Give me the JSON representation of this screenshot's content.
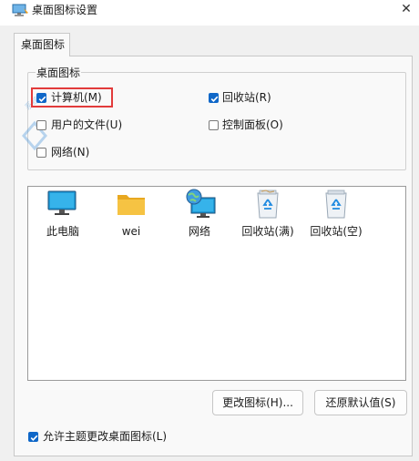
{
  "window": {
    "title": "桌面图标设置",
    "close_glyph": "✕"
  },
  "tabs": [
    {
      "label": "桌面图标"
    }
  ],
  "group": {
    "title": "桌面图标",
    "checkboxes": [
      {
        "label": "计算机(M)",
        "checked": true
      },
      {
        "label": "回收站(R)",
        "checked": true
      },
      {
        "label": "用户的文件(U)",
        "checked": false
      },
      {
        "label": "控制面板(O)",
        "checked": false
      },
      {
        "label": "网络(N)",
        "checked": false
      }
    ]
  },
  "icons": [
    {
      "label": "此电脑",
      "icon": "monitor-icon"
    },
    {
      "label": "wei",
      "icon": "folder-icon"
    },
    {
      "label": "网络",
      "icon": "network-globe-icon"
    },
    {
      "label": "回收站(满)",
      "icon": "recycle-bin-full-icon"
    },
    {
      "label": "回收站(空)",
      "icon": "recycle-bin-empty-icon"
    }
  ],
  "buttons": {
    "change_icon": "更改图标(H)...",
    "restore_default": "还原默认值(S)"
  },
  "bottom_checkbox": {
    "label": "允许主题更改桌面图标(L)",
    "checked": true
  },
  "colors": {
    "accent": "#0f67c8",
    "highlight_border": "#e23b3b",
    "folder": "#f6c343",
    "monitor": "#1e9ad6"
  }
}
